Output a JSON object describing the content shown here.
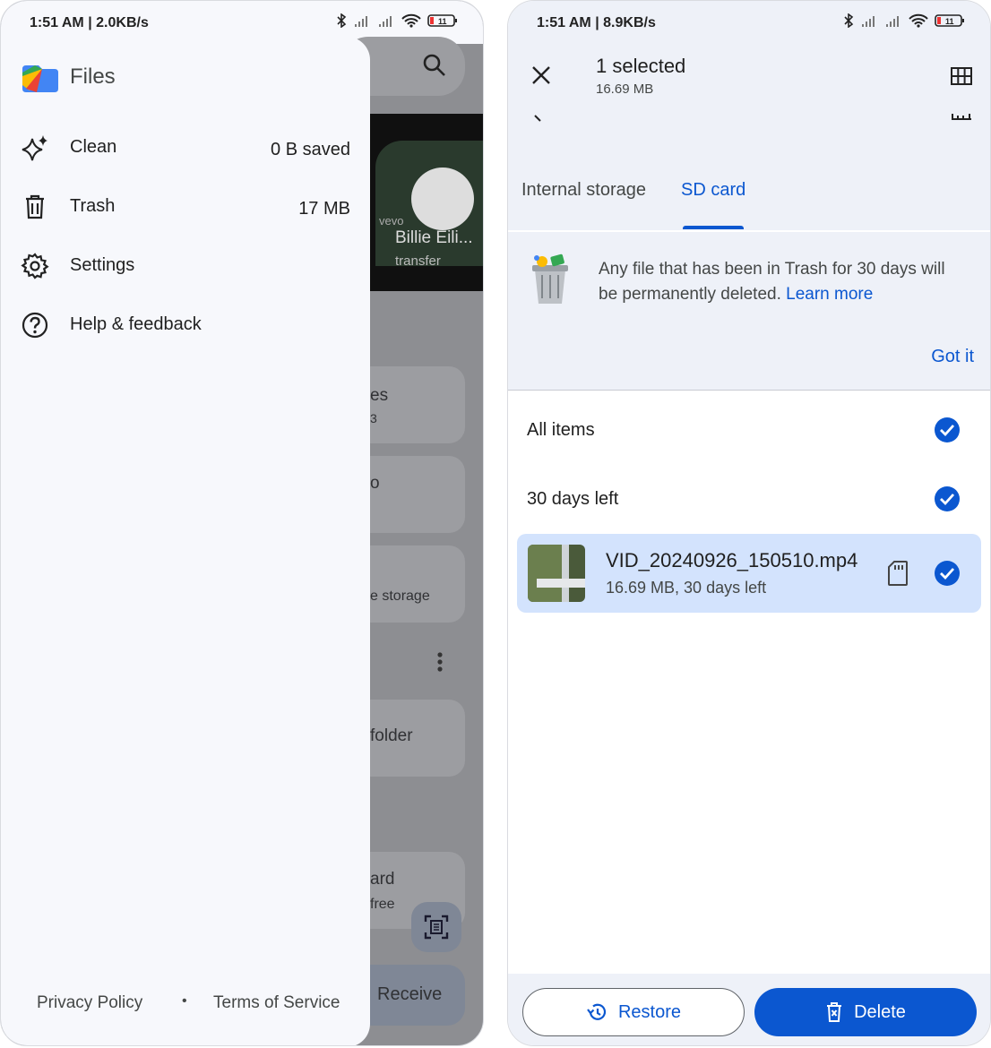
{
  "left": {
    "status": {
      "time": "1:51 AM",
      "speed": "2.0KB/s",
      "battery": "11"
    },
    "background": {
      "video_title": "Billie Eili...",
      "video_subtitle": "transfer",
      "video_brand": "vevo",
      "card_text_1": "es",
      "card_text_1b": "3",
      "card_text_2": "o",
      "card_text_3": "e storage",
      "card_text_4": "folder",
      "card_text_5": "ard",
      "card_text_5b": "free",
      "receive_label": "Receive"
    },
    "drawer": {
      "app_name": "Files",
      "items": [
        {
          "label": "Clean",
          "value": "0 B saved",
          "icon": "sparkle-icon"
        },
        {
          "label": "Trash",
          "value": "17 MB",
          "icon": "trash-icon"
        },
        {
          "label": "Settings",
          "value": "",
          "icon": "gear-icon"
        },
        {
          "label": "Help & feedback",
          "value": "",
          "icon": "help-icon"
        }
      ],
      "footer": {
        "privacy": "Privacy Policy",
        "dot": "•",
        "terms": "Terms of Service"
      }
    }
  },
  "right": {
    "status": {
      "time": "1:51 AM",
      "speed": "8.9KB/s",
      "battery": "11"
    },
    "header": {
      "title": "1 selected",
      "subtitle": "16.69 MB"
    },
    "tabs": [
      {
        "label": "Internal storage",
        "active": false
      },
      {
        "label": "SD card",
        "active": true
      }
    ],
    "notice": {
      "text": "Any file that has been in Trash for 30 days will be permanently deleted.",
      "link": "Learn more",
      "action": "Got it"
    },
    "sections": {
      "all_items": "All items",
      "group": "30 days left"
    },
    "file": {
      "name": "VID_20240926_150510.mp4",
      "meta": "16.69 MB, 30 days left"
    },
    "actions": {
      "restore": "Restore",
      "delete": "Delete"
    },
    "colors": {
      "accent": "#0b57d0",
      "selected_row": "#d3e3fd",
      "surface": "#eef1f8"
    }
  }
}
